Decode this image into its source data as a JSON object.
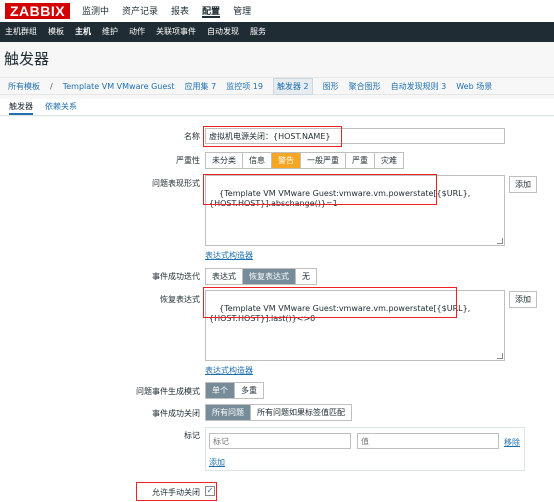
{
  "app": {
    "logo": "ZABBIX",
    "topnav": [
      "监测中",
      "资产记录",
      "报表",
      "配置",
      "管理"
    ],
    "topnav_active": 3,
    "subnav": [
      "主机群组",
      "模板",
      "主机",
      "维护",
      "动作",
      "关联项事件",
      "自动发现",
      "服务"
    ],
    "subnav_active": 2
  },
  "page": {
    "title": "触发器",
    "breadcrumb": {
      "all_templates": "所有模板",
      "separator": "/",
      "template": "Template VM VMware Guest",
      "apps": "应用集 7",
      "items": "监控项 19",
      "triggers": "触发器 2",
      "graphs": "图形",
      "screens": "聚合图形",
      "discovery": "自动发现规则 3",
      "web": "Web 场景"
    },
    "tabs": [
      "触发器",
      "依赖关系"
    ]
  },
  "form": {
    "name_label": "名称",
    "name_value": "虚拟机电源关闭：{HOST.NAME}",
    "severity_label": "严重性",
    "severity_options": [
      "未分类",
      "信息",
      "警告",
      "一般严重",
      "严重",
      "灾难"
    ],
    "severity_selected": "警告",
    "expression_label": "问题表现形式",
    "expression_value": "{Template VM VMware Guest:vmware.vm.powerstate[{$URL},\n{HOST.HOST}].abschange()}=1",
    "add_label": "添加",
    "expr_builder_link": "表达式构造器",
    "ok_event_label": "事件成功迭代",
    "ok_event_options": [
      "表达式",
      "恢复表达式",
      "无"
    ],
    "ok_event_selected": "恢复表达式",
    "recovery_label": "恢复表达式",
    "recovery_value": "{Template VM VMware Guest:vmware.vm.powerstate[{$URL},\n{HOST.HOST}].last()}<>0",
    "recovery_builder_link": "表达式构造器",
    "gen_mode_label": "问题事件生成模式",
    "gen_mode_options": [
      "单个",
      "多重"
    ],
    "gen_mode_selected": "单个",
    "ok_close_label": "事件成功关闭",
    "ok_close_options": [
      "所有问题",
      "所有问题如果标签值匹配"
    ],
    "ok_close_selected": "所有问题",
    "tags_label": "标记",
    "tag_placeholder": "标记",
    "value_placeholder": "值",
    "remove_link": "移除",
    "add_link": "添加",
    "manual_close_label": "允许手动关闭",
    "manual_close_checked": "✓"
  },
  "colors": {
    "brand_red": "#d40000",
    "nav_dark": "#1f2c33",
    "warning_orange": "#f5a623",
    "link_blue": "#1f70b0",
    "annotation_red": "#ee2222"
  }
}
